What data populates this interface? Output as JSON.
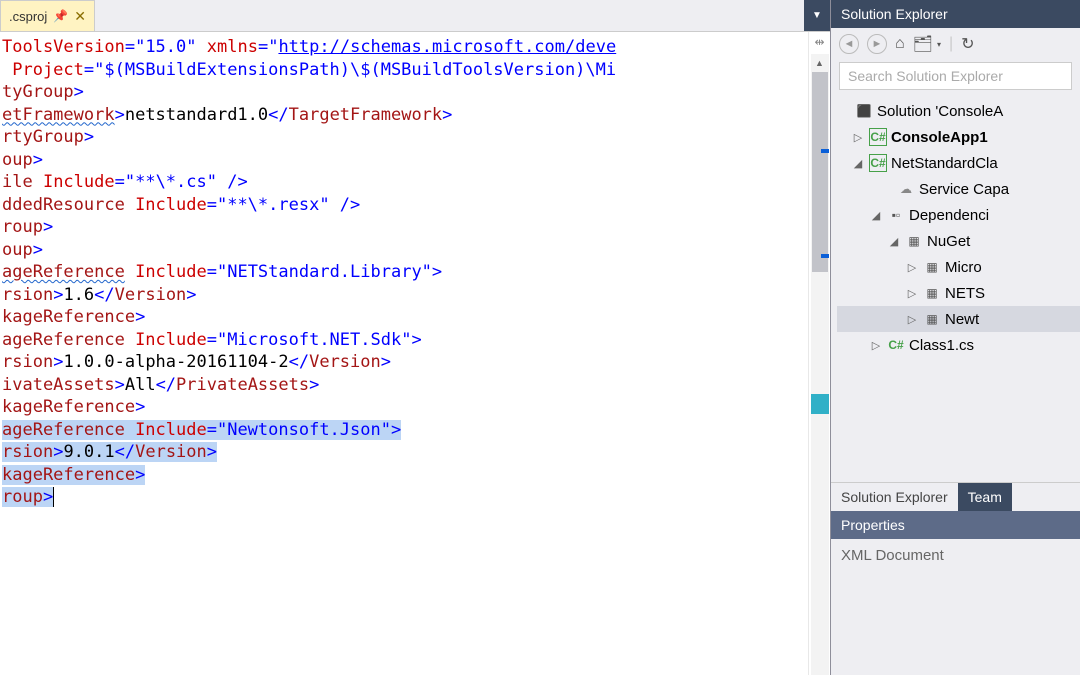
{
  "tab": {
    "label": ".csproj",
    "pin": "📌",
    "close": "✕"
  },
  "code_lines": [
    [
      {
        "t": "ToolsVersion",
        "c": "attr"
      },
      {
        "t": "=",
        "c": "sym"
      },
      {
        "t": "\"15.0\"",
        "c": "str"
      },
      {
        "t": " ",
        "c": "txt"
      },
      {
        "t": "xmlns",
        "c": "attr"
      },
      {
        "t": "=",
        "c": "sym"
      },
      {
        "t": "\"",
        "c": "str"
      },
      {
        "t": "http://schemas.microsoft.com/deve",
        "c": "link"
      }
    ],
    [
      {
        "t": " Project",
        "c": "attr"
      },
      {
        "t": "=",
        "c": "sym"
      },
      {
        "t": "\"$(MSBuildExtensionsPath)\\$(MSBuildToolsVersion)\\Mi",
        "c": "str"
      }
    ],
    [
      {
        "t": "tyGroup",
        "c": "tag"
      },
      {
        "t": ">",
        "c": "sym"
      }
    ],
    [
      {
        "t": "etFramework",
        "c": "tag squiggle"
      },
      {
        "t": ">",
        "c": "sym"
      },
      {
        "t": "netstandard1.0",
        "c": "txt"
      },
      {
        "t": "</",
        "c": "sym"
      },
      {
        "t": "TargetFramework",
        "c": "tag"
      },
      {
        "t": ">",
        "c": "sym"
      }
    ],
    [
      {
        "t": "rtyGroup",
        "c": "tag"
      },
      {
        "t": ">",
        "c": "sym"
      }
    ],
    [
      {
        "t": "oup",
        "c": "tag"
      },
      {
        "t": ">",
        "c": "sym"
      }
    ],
    [
      {
        "t": "ile ",
        "c": "tag"
      },
      {
        "t": "Include",
        "c": "attr"
      },
      {
        "t": "=",
        "c": "sym"
      },
      {
        "t": "\"**\\*.cs\"",
        "c": "str"
      },
      {
        "t": " />",
        "c": "sym"
      }
    ],
    [
      {
        "t": "ddedResource ",
        "c": "tag"
      },
      {
        "t": "Include",
        "c": "attr"
      },
      {
        "t": "=",
        "c": "sym"
      },
      {
        "t": "\"**\\*.resx\"",
        "c": "str"
      },
      {
        "t": " />",
        "c": "sym"
      }
    ],
    [
      {
        "t": "roup",
        "c": "tag"
      },
      {
        "t": ">",
        "c": "sym"
      }
    ],
    [
      {
        "t": "oup",
        "c": "tag"
      },
      {
        "t": ">",
        "c": "sym"
      }
    ],
    [
      {
        "t": "ageReference",
        "c": "tag squiggle"
      },
      {
        "t": " ",
        "c": "txt"
      },
      {
        "t": "Include",
        "c": "attr"
      },
      {
        "t": "=",
        "c": "sym"
      },
      {
        "t": "\"NETStandard.Library\"",
        "c": "str"
      },
      {
        "t": ">",
        "c": "sym"
      }
    ],
    [
      {
        "t": "rsion",
        "c": "tag"
      },
      {
        "t": ">",
        "c": "sym"
      },
      {
        "t": "1.6",
        "c": "txt"
      },
      {
        "t": "</",
        "c": "sym"
      },
      {
        "t": "Version",
        "c": "tag"
      },
      {
        "t": ">",
        "c": "sym"
      }
    ],
    [
      {
        "t": "kageReference",
        "c": "tag"
      },
      {
        "t": ">",
        "c": "sym"
      }
    ],
    [
      {
        "t": "ageReference ",
        "c": "tag"
      },
      {
        "t": "Include",
        "c": "attr"
      },
      {
        "t": "=",
        "c": "sym"
      },
      {
        "t": "\"Microsoft.NET.Sdk\"",
        "c": "str"
      },
      {
        "t": ">",
        "c": "sym"
      }
    ],
    [
      {
        "t": "rsion",
        "c": "tag"
      },
      {
        "t": ">",
        "c": "sym"
      },
      {
        "t": "1.0.0-alpha-20161104-2",
        "c": "txt"
      },
      {
        "t": "</",
        "c": "sym"
      },
      {
        "t": "Version",
        "c": "tag"
      },
      {
        "t": ">",
        "c": "sym"
      }
    ],
    [
      {
        "t": "ivateAssets",
        "c": "tag"
      },
      {
        "t": ">",
        "c": "sym"
      },
      {
        "t": "All",
        "c": "txt"
      },
      {
        "t": "</",
        "c": "sym"
      },
      {
        "t": "PrivateAssets",
        "c": "tag"
      },
      {
        "t": ">",
        "c": "sym"
      }
    ],
    [
      {
        "t": "kageReference",
        "c": "tag"
      },
      {
        "t": ">",
        "c": "sym"
      }
    ],
    [
      {
        "t": "ageReference ",
        "c": "tag sel"
      },
      {
        "t": "Include",
        "c": "attr sel"
      },
      {
        "t": "=",
        "c": "sym sel"
      },
      {
        "t": "\"Newtonsoft.Json\"",
        "c": "str sel"
      },
      {
        "t": ">",
        "c": "sym sel"
      }
    ],
    [
      {
        "t": "rsion",
        "c": "tag sel"
      },
      {
        "t": ">",
        "c": "sym sel"
      },
      {
        "t": "9.0.1",
        "c": "txt sel"
      },
      {
        "t": "</",
        "c": "sym sel"
      },
      {
        "t": "Version",
        "c": "tag sel"
      },
      {
        "t": ">",
        "c": "sym sel"
      }
    ],
    [
      {
        "t": "kageReference",
        "c": "tag sel"
      },
      {
        "t": ">",
        "c": "sym sel"
      }
    ],
    [
      {
        "t": "roup",
        "c": "tag sel"
      },
      {
        "t": ">",
        "c": "sym sel"
      }
    ]
  ],
  "solution_explorer": {
    "title": "Solution Explorer",
    "search_placeholder": "Search Solution Explorer",
    "tree": {
      "solution": "Solution 'ConsoleA",
      "project1": "ConsoleApp1",
      "project2": "NetStandardCla",
      "service": "Service Capa",
      "dependencies": "Dependenci",
      "nuget": "NuGet",
      "pkg1": "Micro",
      "pkg2": "NETS",
      "pkg3": "Newt",
      "class1": "Class1.cs"
    }
  },
  "bottom_tabs": {
    "se": "Solution Explorer",
    "team": "Team"
  },
  "properties": {
    "title": "Properties",
    "body": "XML Document"
  }
}
